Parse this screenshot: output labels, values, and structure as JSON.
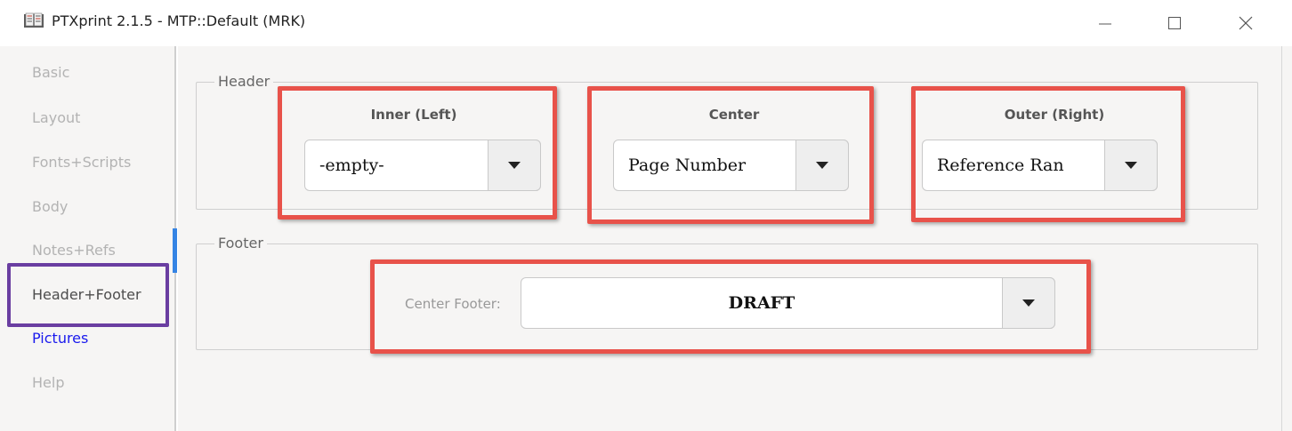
{
  "window": {
    "title": "PTXprint 2.1.5  -  MTP::Default  (MRK)"
  },
  "sidebar": {
    "items": [
      {
        "label": "Basic",
        "state": "disabled"
      },
      {
        "label": "Layout",
        "state": "disabled"
      },
      {
        "label": "Fonts+Scripts",
        "state": "disabled"
      },
      {
        "label": "Body",
        "state": "disabled"
      },
      {
        "label": "Notes+Refs",
        "state": "disabled"
      },
      {
        "label": "Header+Footer",
        "state": "active"
      },
      {
        "label": "Pictures",
        "state": "link"
      },
      {
        "label": "Help",
        "state": "disabled"
      }
    ]
  },
  "header": {
    "legend": "Header",
    "inner": {
      "label": "Inner (Left)",
      "value": "-empty-"
    },
    "center": {
      "label": "Center",
      "value": "Page Number"
    },
    "outer": {
      "label": "Outer (Right)",
      "value": "Reference Ran"
    }
  },
  "footer": {
    "legend": "Footer",
    "center_label": "Center Footer:",
    "center_value": "DRAFT"
  },
  "colors": {
    "highlight_red": "#e8524a",
    "highlight_purple": "#6a3ea1",
    "active_accent": "#3584e4",
    "link": "#1a1aee"
  }
}
